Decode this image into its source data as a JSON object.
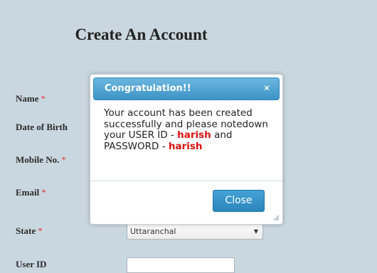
{
  "form": {
    "title": "Create An Account",
    "required_mark": "*",
    "fields": {
      "name": "Name",
      "dob": "Date of Birth",
      "mobile": "Mobile No.",
      "email": "Email",
      "state": "State",
      "userid": "User ID"
    },
    "state_value": "Uttaranchal"
  },
  "dialog": {
    "title": "Congratulation!!",
    "close_icon": "×",
    "message_1": "Your account has been created successfully and please notedown your USER ID - ",
    "user_id": "harish",
    "message_2": " and PASSWORD - ",
    "password": "harish",
    "close_label": "Close"
  },
  "colors": {
    "background": "#c9d7e0",
    "accent": "#3d94c6",
    "highlight": "#e01010"
  }
}
